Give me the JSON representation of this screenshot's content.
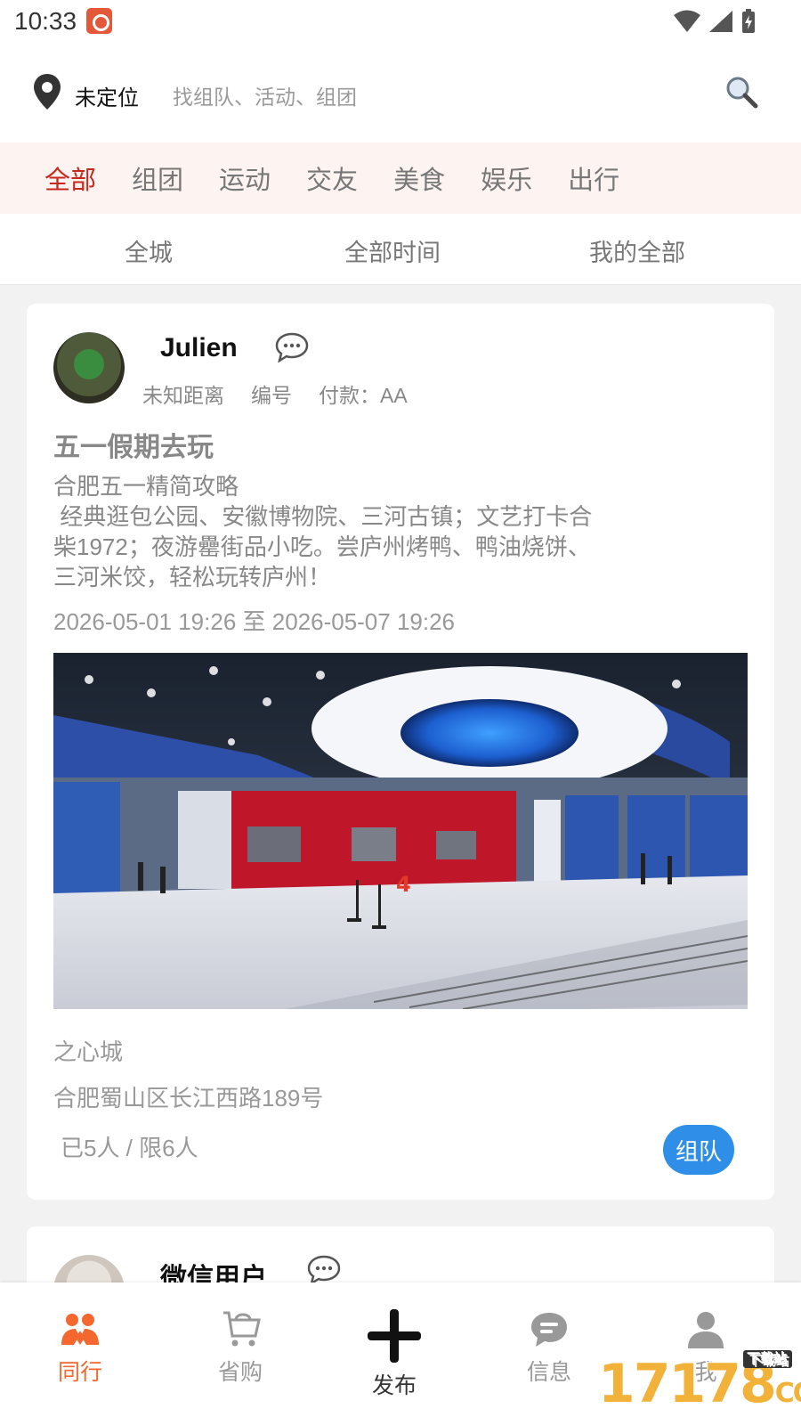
{
  "status_bar": {
    "time": "10:33"
  },
  "header": {
    "location_label": "未定位",
    "search_placeholder": "找组队、活动、组团"
  },
  "categories": [
    {
      "label": "全部",
      "active": true
    },
    {
      "label": "组团"
    },
    {
      "label": "运动"
    },
    {
      "label": "交友"
    },
    {
      "label": "美食"
    },
    {
      "label": "娱乐"
    },
    {
      "label": "出行"
    }
  ],
  "filters": {
    "city": "全城",
    "time": "全部时间",
    "mine": "我的全部"
  },
  "posts": [
    {
      "username": "Julien",
      "distance": "未知距离",
      "number_label": "编号",
      "payment": "付款：AA",
      "title": "五一假期去玩",
      "description": "合肥五一精简攻略\n 经典逛包公园、安徽博物院、三河古镇；文艺打卡合\n柴1972；夜游罍街品小吃。尝庐州烤鸭、鸭油烧饼、\n三河米饺，轻松玩转庐州！",
      "date_range": "2026-05-01 19:26 至 2026-05-07 19:26",
      "place": "之心城",
      "address": "合肥蜀山区长江西路189号",
      "members": "已5人 / 限6人",
      "action_label": "组队"
    },
    {
      "username": "微信用户"
    }
  ],
  "bottom_nav": [
    {
      "label": "同行",
      "icon": "people-icon",
      "active": true
    },
    {
      "label": "省购",
      "icon": "basket-icon"
    },
    {
      "label": "发布",
      "icon": "plus-icon"
    },
    {
      "label": "信息",
      "icon": "message-icon"
    },
    {
      "label": "我",
      "icon": "user-icon"
    }
  ],
  "watermark": {
    "text": "17178",
    "domain": "COM",
    "tag": "下载站"
  },
  "colors": {
    "active_category": "#c9271b",
    "active_nav": "#f4672f",
    "team_button": "#2e8ee8",
    "category_bar_bg": "#fdf4f2"
  }
}
